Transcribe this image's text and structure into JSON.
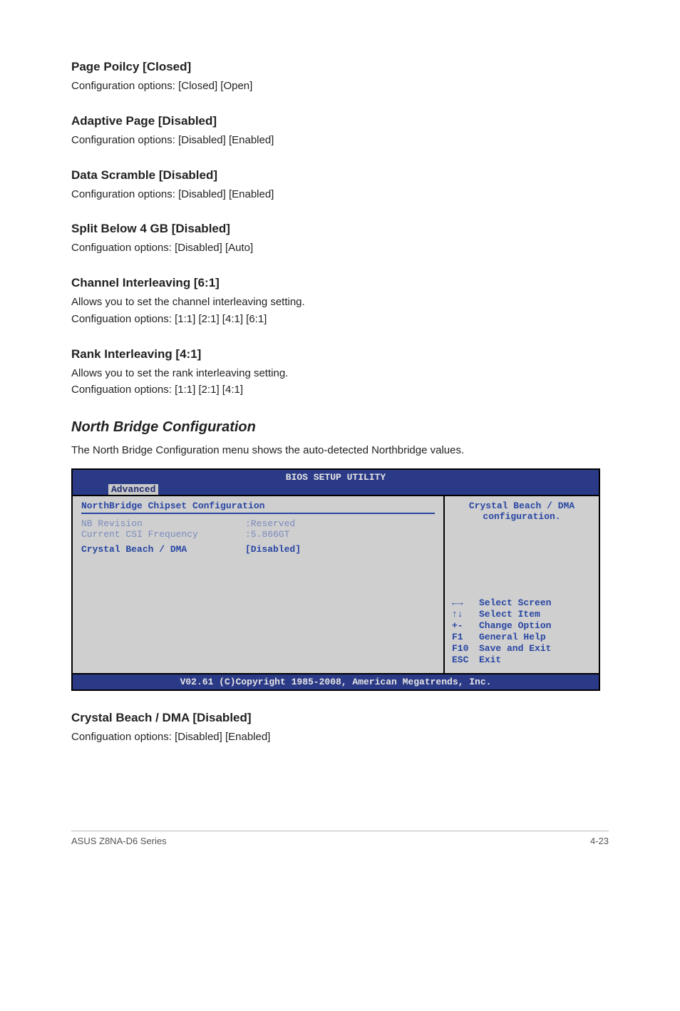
{
  "sections": {
    "pagePolicy": {
      "heading": "Page Poilcy [Closed]",
      "body": "Configuration options: [Closed] [Open]"
    },
    "adaptivePage": {
      "heading": "Adaptive Page [Disabled]",
      "body": "Configuration options: [Disabled] [Enabled]"
    },
    "dataScramble": {
      "heading": "Data Scramble [Disabled]",
      "body": "Configuration options: [Disabled] [Enabled]"
    },
    "splitBelow": {
      "heading": "Split Below 4 GB [Disabled]",
      "body": "Configuation options: [Disabled] [Auto]"
    },
    "chanInter": {
      "heading": "Channel Interleaving [6:1]",
      "body1": "Allows you to set the channel interleaving setting.",
      "body2": "Configuation options: [1:1] [2:1] [4:1] [6:1]"
    },
    "rankInter": {
      "heading": "Rank Interleaving [4:1]",
      "body1": "Allows you to set the rank interleaving setting.",
      "body2": "Configuation options: [1:1] [2:1] [4:1]"
    },
    "northBridge": {
      "heading": "North Bridge Configuration",
      "body": "The North Bridge Configuration menu shows the auto-detected Northbridge values."
    },
    "crystalDma": {
      "heading": "Crystal Beach / DMA [Disabled]",
      "body": "Configuation options: [Disabled] [Enabled]"
    }
  },
  "bios": {
    "title": "BIOS SETUP UTILITY",
    "tab": "Advanced",
    "sectionHeader": "NorthBridge Chipset Configuration",
    "rows": {
      "nbRev": {
        "k": "NB Revision",
        "v": ":Reserved"
      },
      "csi": {
        "k": "Current CSI Frequency",
        "v": ":5.866GT"
      },
      "cb": {
        "k": "Crystal Beach / DMA",
        "v": "[Disabled]"
      }
    },
    "help": {
      "line1": "Crystal Beach / DMA",
      "line2": "configuration.",
      "keys": {
        "selScreen": "Select Screen",
        "selItem": "Select Item",
        "change": "Change Option",
        "gen": "General Help",
        "save": "Save and Exit",
        "exit": "Exit"
      }
    },
    "footer": "V02.61 (C)Copyright 1985-2008, American Megatrends, Inc."
  },
  "pageFooter": {
    "left": "ASUS Z8NA-D6 Series",
    "right": "4-23"
  }
}
